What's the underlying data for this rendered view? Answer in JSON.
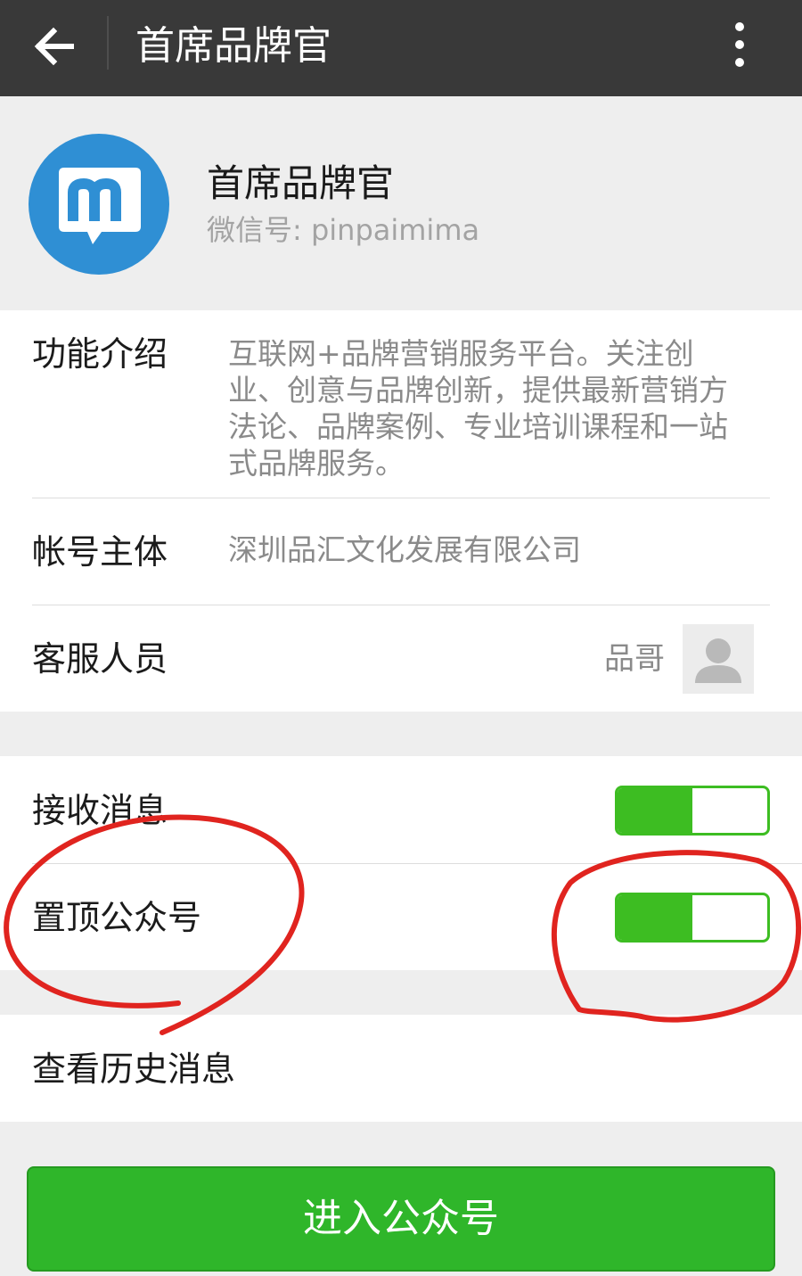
{
  "header": {
    "title": "首席品牌官",
    "back_icon": "arrow-left-icon",
    "more_icon": "more-vertical-icon"
  },
  "profile": {
    "name": "首席品牌官",
    "wechat_id": "微信号: pinpaimima",
    "avatar_icon": "brand-logo-m-icon"
  },
  "info": {
    "intro_label": "功能介绍",
    "intro_lines": [
      "互联网+品牌营销服务平台。关注创",
      "业、创意与品牌创新，提供最新营销方",
      "法论、品牌案例、专业培训课程和一站",
      "式品牌服务。"
    ],
    "entity_label": "帐号主体",
    "entity_value": "深圳品汇文化发展有限公司",
    "cs_label": "客服人员",
    "cs_name": "品哥",
    "cs_avatar_icon": "person-silhouette-icon"
  },
  "settings": {
    "receive_label": "接收消息",
    "receive_on": true,
    "pin_label": "置顶公众号",
    "pin_on": true
  },
  "history": {
    "label": "查看历史消息"
  },
  "enter_button": "进入公众号",
  "colors": {
    "topbar": "#393939",
    "brand_blue": "#2f8fd4",
    "switch_green": "#3dbd22",
    "button_green": "#2fb62a",
    "annotation_red": "#e0241f"
  }
}
